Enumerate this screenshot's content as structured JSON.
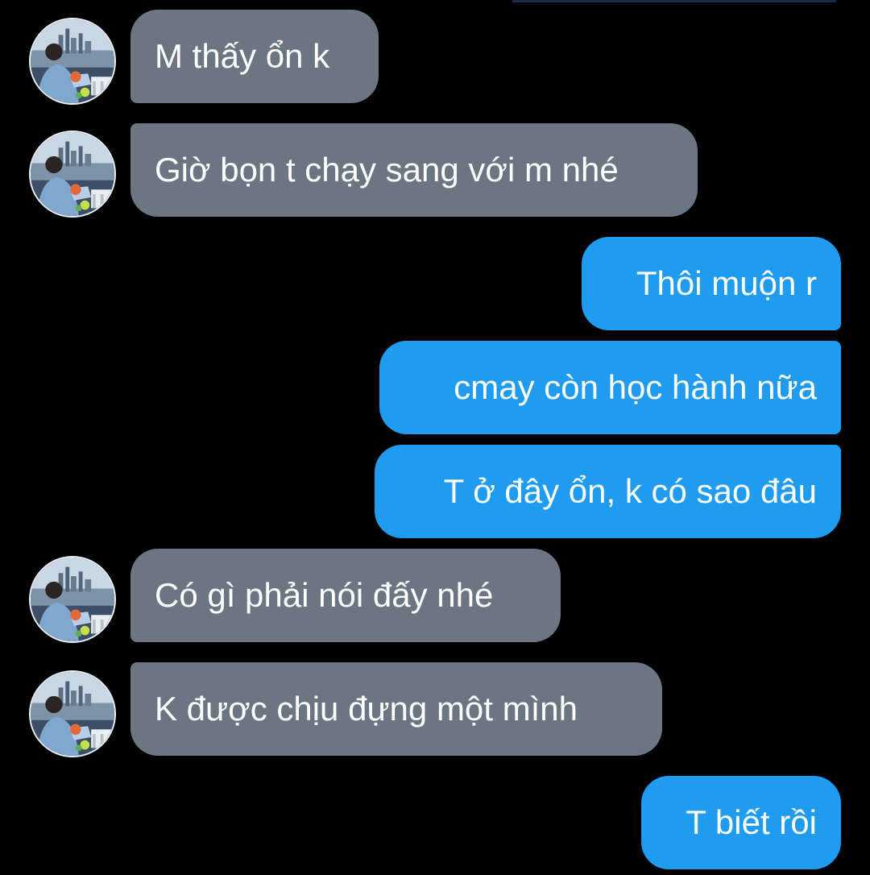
{
  "colors": {
    "background": "#000000",
    "incoming_bubble": "#6b7682",
    "outgoing_bubble": "#1f9bf0",
    "text": "#ffffff"
  },
  "messages": [
    {
      "direction": "incoming",
      "text": "M thấy ổn k",
      "avatar_icon": "contact-avatar-icon"
    },
    {
      "direction": "incoming",
      "text": "Giờ bọn t chạy sang với m nhé",
      "avatar_icon": "contact-avatar-icon"
    },
    {
      "direction": "outgoing",
      "text": "Thôi muộn r"
    },
    {
      "direction": "outgoing",
      "text": "cmay còn học hành nữa"
    },
    {
      "direction": "outgoing",
      "text": "T ở đây ổn, k có sao đâu"
    },
    {
      "direction": "incoming",
      "text": "Có gì phải nói đấy nhé",
      "avatar_icon": "contact-avatar-icon"
    },
    {
      "direction": "incoming",
      "text": "K được chịu đựng một mình",
      "avatar_icon": "contact-avatar-icon"
    },
    {
      "direction": "outgoing",
      "text": "T biết rồi"
    }
  ]
}
